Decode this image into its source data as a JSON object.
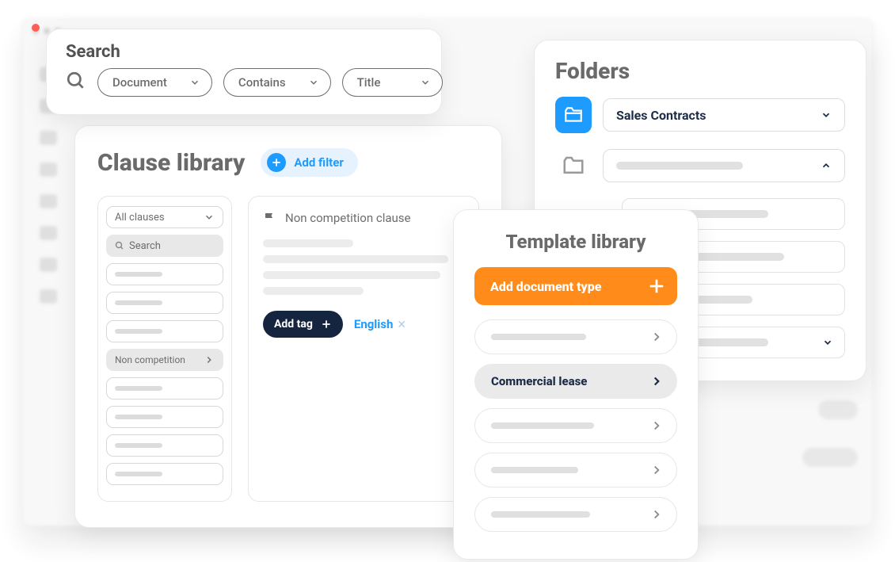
{
  "search": {
    "title": "Search",
    "filters": {
      "field": "Document",
      "operator": "Contains",
      "value": "Title"
    }
  },
  "folders": {
    "title": "Folders",
    "selected": "Sales Contracts"
  },
  "clause_library": {
    "title": "Clause library",
    "add_filter_label": "Add filter",
    "all_clauses_label": "All clauses",
    "search_placeholder": "Search",
    "selected_item": "Non competition",
    "right": {
      "heading": "Non competition clause",
      "add_tag_label": "Add tag",
      "language": "English"
    }
  },
  "template_library": {
    "title": "Template library",
    "add_button": "Add document type",
    "selected": "Commercial lease"
  },
  "colors": {
    "accent_blue": "#1E9BFF",
    "accent_orange": "#FF8C1A",
    "dark": "#16253f"
  }
}
